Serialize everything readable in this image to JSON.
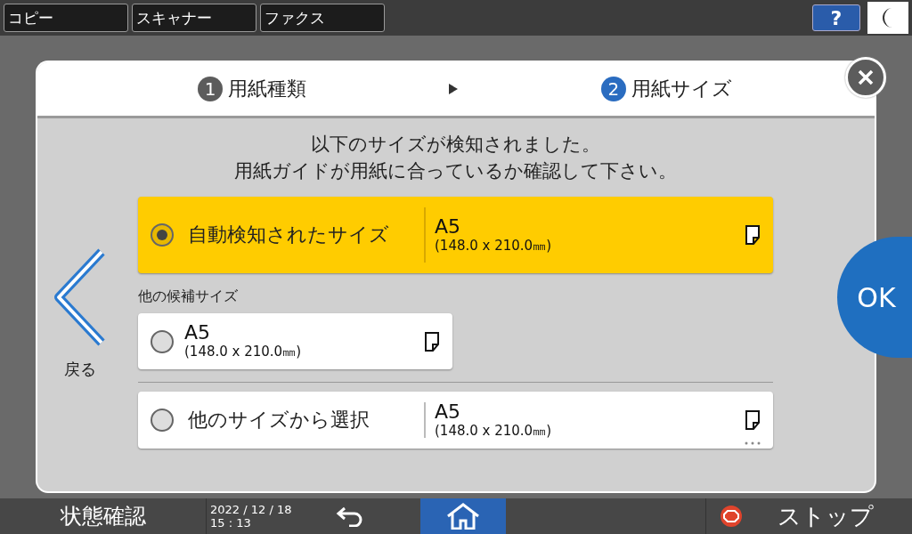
{
  "top_tabs": [
    {
      "label": "コピー"
    },
    {
      "label": "スキャナー"
    },
    {
      "label": "ファクス"
    }
  ],
  "help_button": "?",
  "dialog": {
    "steps": [
      {
        "number": "1",
        "label": "用紙種類",
        "selected": false
      },
      {
        "number": "2",
        "label": "用紙サイズ",
        "selected": true
      }
    ],
    "message": [
      "以下のサイズが検知されました。",
      "用紙ガイドが用紙に合っているか確認して下さい。"
    ],
    "back_label": "戻る",
    "ok_button": "OK",
    "candidates_heading": "他の候補サイズ",
    "options": [
      {
        "kind": "detected",
        "label": "自動検知されたサイズ",
        "size": "A5",
        "dimensions": "(148.0 x 210.0㎜)",
        "selected": true
      },
      {
        "kind": "candidate",
        "size": "A5",
        "dimensions": "(148.0 x 210.0㎜)",
        "selected": false
      },
      {
        "kind": "other",
        "label": "他のサイズから選択",
        "size": "A5",
        "dimensions": "(148.0 x 210.0㎜)",
        "selected": false
      }
    ]
  },
  "bottom_bar": {
    "status": "状態確認",
    "date": "2022 / 12 / 18",
    "time": "15 : 13",
    "stop": "ストップ"
  }
}
